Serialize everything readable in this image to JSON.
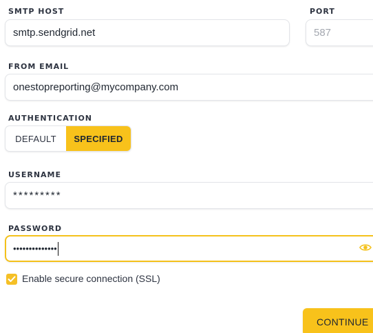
{
  "smtp_host": {
    "label": "SMTP HOST",
    "value": "smtp.sendgrid.net"
  },
  "port": {
    "label": "PORT",
    "value": "587"
  },
  "from_email": {
    "label": "FROM EMAIL",
    "value": "onestopreporting@mycompany.com"
  },
  "authentication": {
    "label": "AUTHENTICATION",
    "options": [
      "DEFAULT",
      "SPECIFIED"
    ],
    "selected": "SPECIFIED"
  },
  "username": {
    "label": "USERNAME",
    "value": "*********"
  },
  "password": {
    "label": "PASSWORD",
    "value": "••••••••••••••"
  },
  "ssl": {
    "label": "Enable secure connection (SSL)",
    "checked": true
  },
  "continue_label": "CONTINUE",
  "colors": {
    "accent": "#f8c21b",
    "border": "#e2e4e8",
    "text": "#1f2630"
  }
}
